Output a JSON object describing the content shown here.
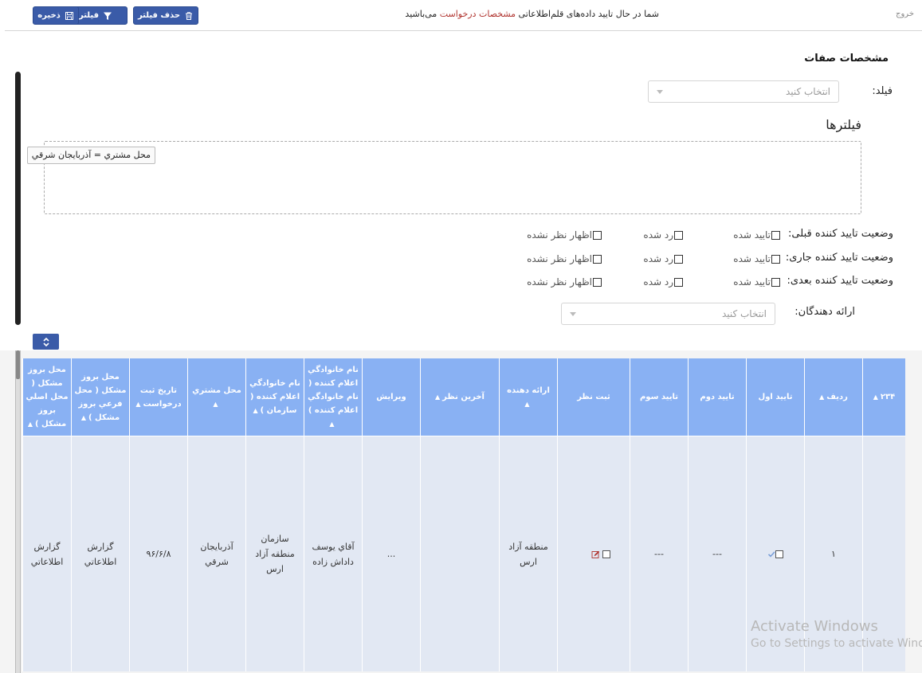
{
  "toolbar": {
    "exit_label": "خروج",
    "message_prefix": "شما در حال تایید داده‌های قلم‌اطلاعاتی",
    "message_highlight": "مشخصات درخواست",
    "message_suffix": "می‌باشید",
    "delete_filter_label": "حذف فیلتر",
    "filter_label": "فیلتر",
    "save_label": "ذخیره",
    "accent_color": "#3a5ba8",
    "highlight_color": "#b0332e"
  },
  "form": {
    "section_title": "مشخصات صفات",
    "field_label": "فیلد:",
    "field_placeholder": "انتخاب کنید",
    "filters_title": "فیلترها",
    "filter_chips": [
      "محل مشتري = آذربايجان شرقي"
    ],
    "status_rows": [
      {
        "label": "وضعیت تایید کننده قبلی:",
        "options": [
          "تایید شده",
          "رد شده",
          "اظهار نظر نشده"
        ]
      },
      {
        "label": "وضعیت تایید کننده جاری:",
        "options": [
          "تایید شده",
          "رد شده",
          "اظهار نظر نشده"
        ]
      },
      {
        "label": "وضعیت تایید کننده بعدی:",
        "options": [
          "تایید شده",
          "رد شده",
          "اظهار نظر نشده"
        ]
      }
    ],
    "providers_label": "ارائه دهندگان:",
    "providers_placeholder": "انتخاب کنید"
  },
  "table": {
    "header_color": "#89b1f3",
    "columns": [
      "۲۳۴",
      "رديف",
      "تایید اول",
      "تایید دوم",
      "تایید سوم",
      "ثبت نظر",
      "ارائه دهنده",
      "آخرین نظر",
      "ویرایش",
      "نام خانوادگي اعلام کننده ( نام خانوادگي اعلام کننده )",
      "نام خانوادگي اعلام کننده ( سازمان )",
      "محل مشتري",
      "تاريخ ثبت درخواست",
      "محل بروز مشکل ( محل فرعي بروز مشکل )",
      "محل بروز مشکل ( محل اصلي بروز مشکل )"
    ],
    "row": {
      "index": "",
      "radif": "۱",
      "approve2": "---",
      "approve3": "---",
      "provider": "منطقه آزاد ارس",
      "last_opinion": "",
      "edit": "...",
      "announcer": "آقاي يوسف داداش زاده",
      "organization": "سازمان منطقه آزاد ارس",
      "customer_location": "آذربايجان شرقي",
      "request_date": "۹۶/۶/۸",
      "sub_location": "گزارش اطلاعاتي",
      "main_location": "گزارش اطلاعاتي"
    }
  },
  "watermark": {
    "line1": "Activate Windows",
    "line2": "Go to Settings to activate Windo"
  },
  "icons": {
    "delete": "trash-icon",
    "filter": "funnel-icon",
    "save": "floppy-icon",
    "collapse": "chevron-up-down-icon",
    "edit": "pencil-icon"
  }
}
